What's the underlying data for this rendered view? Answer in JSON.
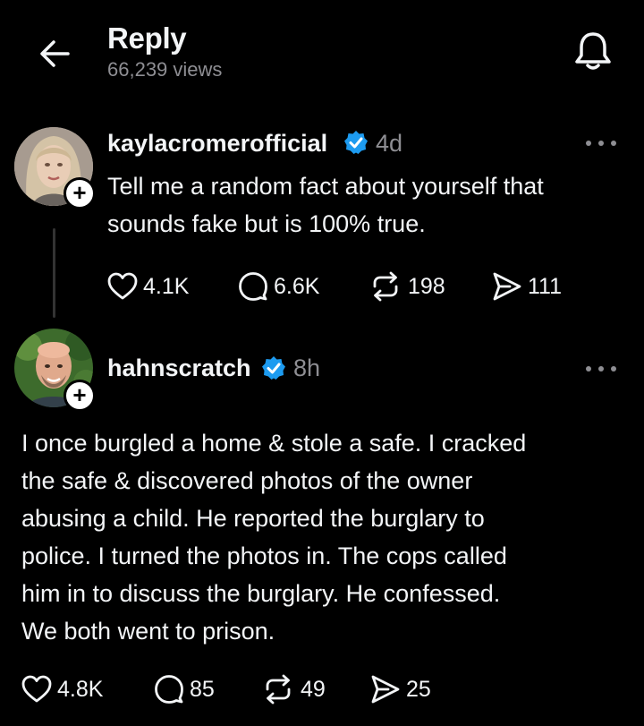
{
  "header": {
    "title": "Reply",
    "views": "66,239 views",
    "back_icon": "arrow-left-icon",
    "bell_icon": "bell-icon"
  },
  "colors": {
    "background": "#000000",
    "text": "#f3f5f7",
    "muted": "#8e8e93",
    "verified": "#1d9bf0"
  },
  "posts": [
    {
      "username": "kaylacromerofficial",
      "time": "4d",
      "text": [
        "Tell me a random fact about yourself that",
        "sounds fake but is 100% true."
      ],
      "likes": "4.1K",
      "comments": "6.6K",
      "reposts": "198",
      "shares": "111"
    },
    {
      "username": "hahnscratch",
      "time": "8h",
      "text": [
        "I once burgled a home & stole a safe. I cracked",
        "the safe & discovered photos of the owner",
        "abusing a child. He reported the burglary to",
        "police. I turned the photos in. The cops called",
        "him in to discuss the burglary. He confessed.",
        "We both went to prison."
      ],
      "likes": "4.8K",
      "comments": "85",
      "reposts": "49",
      "shares": "25"
    }
  ]
}
